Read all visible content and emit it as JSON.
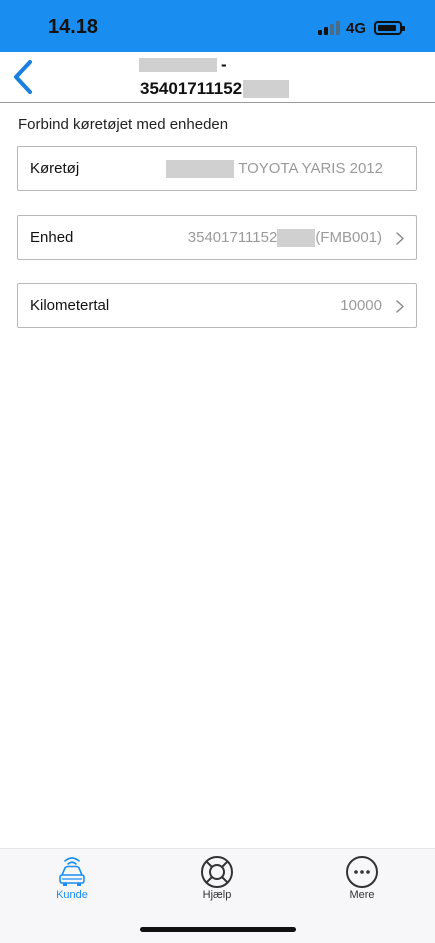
{
  "status_bar": {
    "time": "14.18",
    "network": "4G",
    "bar_color": "#1a8ef0"
  },
  "header": {
    "title_line1_suffix": "-",
    "title_line2": "35401711152",
    "back_icon": "chevron-left-icon",
    "accent": "#1a7fe0"
  },
  "main": {
    "section_label": "Forbind køretøjet med enheden",
    "rows": [
      {
        "label": "Køretøj",
        "value": "TOYOTA YARIS 2012"
      },
      {
        "label": "Enhed",
        "value_prefix": "35401711152",
        "value_suffix": "(FMB001)"
      },
      {
        "label": "Kilometertal",
        "value": "10000"
      }
    ]
  },
  "tabbar": {
    "tabs": [
      {
        "label": "Kunde",
        "icon": "car-icon",
        "active": true
      },
      {
        "label": "Hjælp",
        "icon": "lifebuoy-icon",
        "active": false
      },
      {
        "label": "Mere",
        "icon": "more-icon",
        "active": false
      }
    ],
    "active_color": "#1a8ef0",
    "inactive_color": "#333333"
  }
}
